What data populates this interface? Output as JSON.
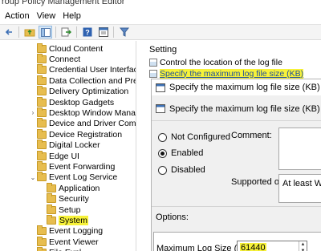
{
  "window": {
    "title": "roup Policy Management Editor"
  },
  "menu": [
    "Action",
    "View",
    "Help"
  ],
  "toolbar": {
    "icons": [
      "back-arrow-icon",
      "forward-arrow-icon",
      "folder-up-icon",
      "show-hide-tree-icon",
      "export-icon",
      "help-icon",
      "properties-icon",
      "filter-icon"
    ]
  },
  "tree": {
    "items": [
      {
        "label": "Cloud Content",
        "expandable": false,
        "indent": 0
      },
      {
        "label": "Connect",
        "expandable": false,
        "indent": 0
      },
      {
        "label": "Credential User Interface",
        "expandable": false,
        "indent": 0
      },
      {
        "label": "Data Collection and Previe",
        "expandable": false,
        "indent": 0
      },
      {
        "label": "Delivery Optimization",
        "expandable": false,
        "indent": 0
      },
      {
        "label": "Desktop Gadgets",
        "expandable": false,
        "indent": 0
      },
      {
        "label": "Desktop Window Manager",
        "expandable": true,
        "indent": 0
      },
      {
        "label": "Device and Driver Compat",
        "expandable": false,
        "indent": 0
      },
      {
        "label": "Device Registration",
        "expandable": false,
        "indent": 0
      },
      {
        "label": "Digital Locker",
        "expandable": false,
        "indent": 0
      },
      {
        "label": "Edge UI",
        "expandable": false,
        "indent": 0
      },
      {
        "label": "Event Forwarding",
        "expandable": false,
        "indent": 0
      },
      {
        "label": "Event Log Service",
        "expanded": true,
        "indent": 0
      },
      {
        "label": "Application",
        "expandable": false,
        "indent": 1
      },
      {
        "label": "Security",
        "expandable": false,
        "indent": 1
      },
      {
        "label": "Setup",
        "expandable": false,
        "indent": 1
      },
      {
        "label": "System",
        "expandable": false,
        "indent": 1,
        "highlighted": true
      },
      {
        "label": "Event Logging",
        "expandable": false,
        "indent": 0
      },
      {
        "label": "Event Viewer",
        "expandable": false,
        "indent": 0
      },
      {
        "label": "File Expl",
        "expandable": true,
        "indent": 0
      }
    ]
  },
  "settings": {
    "header": "Setting",
    "rows": [
      {
        "label": "Control the location of the log file",
        "selected": false
      },
      {
        "label": "Specify the maximum log file size (KB)",
        "selected": true
      }
    ]
  },
  "dialog": {
    "title": "Specify the maximum log file size (KB)",
    "subtitle": "Specify the maximum log file size (KB)",
    "radios": [
      {
        "label": "Not Configured",
        "checked": false
      },
      {
        "label": "Enabled",
        "checked": true
      },
      {
        "label": "Disabled",
        "checked": false
      }
    ],
    "comment_label": "Comment:",
    "supported_label": "Supported on:",
    "supported_value": "At least Win",
    "options_label": "Options:",
    "max_log_label": "Maximum Log Size (KB)",
    "max_log_value": "61440"
  },
  "colors": {
    "highlight": "#f7f239",
    "folder": "#e7bd4f",
    "link": "#1f4e9e"
  }
}
